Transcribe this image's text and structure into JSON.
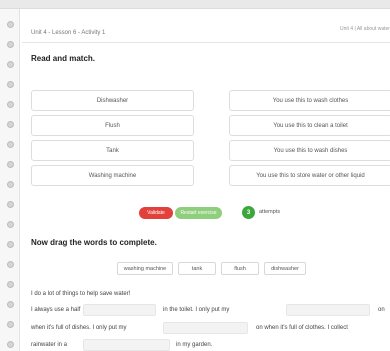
{
  "header": {
    "breadcrumb": "Unit 4 - Lesson 6 - Activity 1",
    "unit_title": "Unit 4 | All about water"
  },
  "match_section": {
    "title": "Read and match.",
    "left_items": [
      "Dishwasher",
      "Flush",
      "Tank",
      "Washing machine"
    ],
    "right_items": [
      "You use this to wash clothes",
      "You use this to clean a toilet",
      "You use this to wash dishes",
      "You use this to store water or other liquid"
    ]
  },
  "controls": {
    "validate_label": "Validate",
    "restart_label": "Restart exercise",
    "attempts_count": "3",
    "attempts_label": "attempts"
  },
  "drag_section": {
    "title": "Now drag the words to complete.",
    "word_bank": [
      "washing machine",
      "tank",
      "flush",
      "dishwasher"
    ],
    "lines": [
      "I do a lot of things to help save water!",
      "I always use a half",
      "in the toilet. I only put my",
      "on",
      "when it's full of dishes. I only put my",
      "on when it's full of clothes. I collect",
      "rainwater in a",
      "in my garden."
    ]
  },
  "colors": {
    "validate": "#e2403a",
    "restart": "#8fce7c",
    "attempts": "#3aa83a"
  }
}
